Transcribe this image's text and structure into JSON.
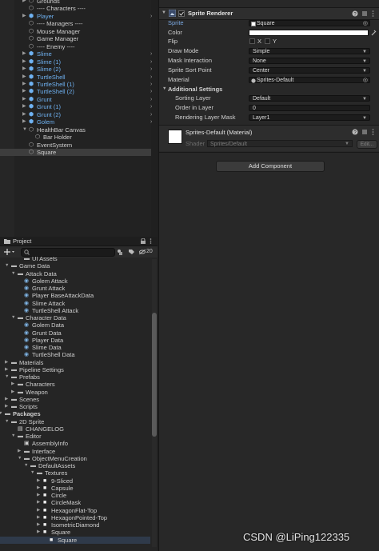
{
  "hierarchy": {
    "rows": [
      {
        "label": "Grounds",
        "icon": "gameobject",
        "blue": false
      },
      {
        "label": "---- Characters ----",
        "icon": "gameobject",
        "blue": false
      },
      {
        "label": "Player",
        "icon": "prefab",
        "blue": true
      },
      {
        "label": "---- Managers ----",
        "icon": "gameobject",
        "blue": false
      },
      {
        "label": "Mouse Manager",
        "icon": "gameobject",
        "blue": false
      },
      {
        "label": "Game Manager",
        "icon": "gameobject",
        "blue": false
      },
      {
        "label": "---- Enemy ----",
        "icon": "gameobject",
        "blue": false
      },
      {
        "label": "Slime",
        "icon": "prefab",
        "blue": true
      },
      {
        "label": "Slime (1)",
        "icon": "prefab",
        "blue": true
      },
      {
        "label": "Slime (2)",
        "icon": "prefab",
        "blue": true
      },
      {
        "label": "TurtleShell",
        "icon": "prefab",
        "blue": true
      },
      {
        "label": "TurtleShell (1)",
        "icon": "prefab",
        "blue": true
      },
      {
        "label": "TurtleShell (2)",
        "icon": "prefab",
        "blue": true
      },
      {
        "label": "Grunt",
        "icon": "prefab",
        "blue": true
      },
      {
        "label": "Grunt (1)",
        "icon": "prefab",
        "blue": true
      },
      {
        "label": "Grunt (2)",
        "icon": "prefab",
        "blue": true
      },
      {
        "label": "Golem",
        "icon": "prefab",
        "blue": true
      },
      {
        "label": "HealthBar Canvas",
        "icon": "gameobject",
        "blue": false
      },
      {
        "label": "Bar Holder",
        "icon": "gameobject",
        "blue": false
      },
      {
        "label": "EventSystem",
        "icon": "gameobject",
        "blue": false
      },
      {
        "label": "Square",
        "icon": "gameobject",
        "blue": false
      }
    ]
  },
  "project": {
    "tab_label": "Project",
    "hidden_count": "20",
    "rows": [
      {
        "label": "UI Assets",
        "type": "folder"
      },
      {
        "label": "Game Data",
        "type": "folder"
      },
      {
        "label": "Attack Data",
        "type": "folder"
      },
      {
        "label": "Golem Attack",
        "type": "asset"
      },
      {
        "label": "Grunt Attack",
        "type": "asset"
      },
      {
        "label": "Player BaseAttackData",
        "type": "asset"
      },
      {
        "label": "Slime Attack",
        "type": "asset"
      },
      {
        "label": "TurtleShell Attack",
        "type": "asset"
      },
      {
        "label": "Character Data",
        "type": "folder"
      },
      {
        "label": "Golem Data",
        "type": "asset"
      },
      {
        "label": "Grunt Data",
        "type": "asset"
      },
      {
        "label": "Player Data",
        "type": "asset"
      },
      {
        "label": "Slime Data",
        "type": "asset"
      },
      {
        "label": "TurtleShell Data",
        "type": "asset"
      },
      {
        "label": "Materials",
        "type": "folder"
      },
      {
        "label": "Pipeline Settings",
        "type": "folder"
      },
      {
        "label": "Prefabs",
        "type": "folder"
      },
      {
        "label": "Characters",
        "type": "folder"
      },
      {
        "label": "Weapon",
        "type": "folder"
      },
      {
        "label": "Scenes",
        "type": "folder"
      },
      {
        "label": "Scripts",
        "type": "folder"
      },
      {
        "label": "Packages",
        "type": "folder"
      },
      {
        "label": "2D Sprite",
        "type": "folder"
      },
      {
        "label": "CHANGELOG",
        "type": "doc"
      },
      {
        "label": "Editor",
        "type": "folder"
      },
      {
        "label": "AssemblyInfo",
        "type": "script"
      },
      {
        "label": "Interface",
        "type": "folder"
      },
      {
        "label": "ObjectMenuCreation",
        "type": "folder"
      },
      {
        "label": "DefaultAssets",
        "type": "folder"
      },
      {
        "label": "Textures",
        "type": "folder"
      },
      {
        "label": "9-Sliced",
        "type": "sprite"
      },
      {
        "label": "Capsule",
        "type": "sprite"
      },
      {
        "label": "Circle",
        "type": "sprite"
      },
      {
        "label": "CircleMask",
        "type": "sprite"
      },
      {
        "label": "HexagonFlat-Top",
        "type": "sprite"
      },
      {
        "label": "HexagonPointed-Top",
        "type": "sprite"
      },
      {
        "label": "IsometricDiamond",
        "type": "sprite"
      },
      {
        "label": "Square",
        "type": "sprite"
      },
      {
        "label": "Square",
        "type": "sprite"
      }
    ]
  },
  "inspector": {
    "component_title": "Sprite Renderer",
    "fields": {
      "sprite_label": "Sprite",
      "sprite_value": "Square",
      "color_label": "Color",
      "flip_label": "Flip",
      "flip_x": "X",
      "flip_y": "Y",
      "draw_mode_label": "Draw Mode",
      "draw_mode_value": "Simple",
      "mask_label": "Mask Interaction",
      "mask_value": "None",
      "sort_point_label": "Sprite Sort Point",
      "sort_point_value": "Center",
      "material_label": "Material",
      "material_value": "Sprites-Default",
      "additional_label": "Additional Settings",
      "sorting_layer_label": "Sorting Layer",
      "sorting_layer_value": "Default",
      "order_label": "Order in Layer",
      "order_value": "0",
      "render_mask_label": "Rendering Layer Mask",
      "render_mask_value": "Layer1"
    },
    "material": {
      "title": "Sprites-Default (Material)",
      "shader_label": "Shader",
      "shader_value": "Sprites/Default",
      "edit_label": "Edit..."
    },
    "add_component_label": "Add Component"
  },
  "watermark": "CSDN @LiPing122335",
  "colors": {
    "accent_blue": "#6fb2f2",
    "asset_blue": "#7fb5e6",
    "panel_bg": "#282828"
  }
}
